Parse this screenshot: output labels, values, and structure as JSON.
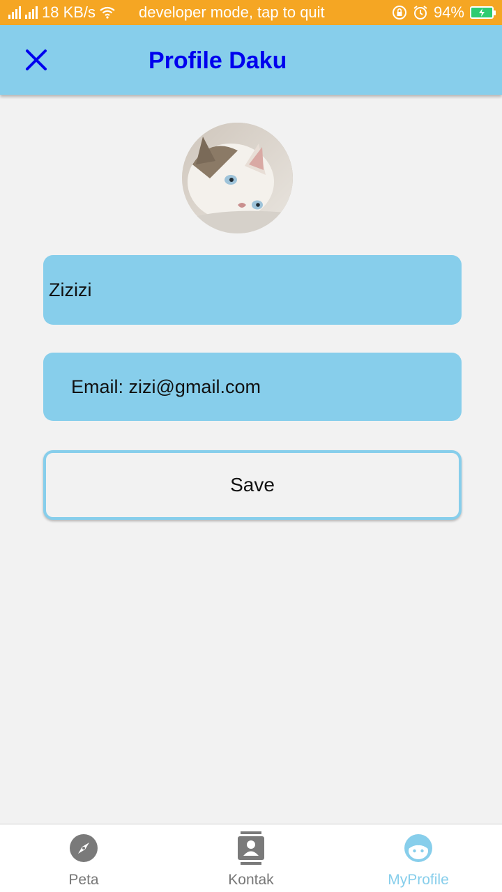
{
  "status_bar": {
    "speed": "18 KB/s",
    "notice": "developer mode, tap to quit",
    "battery": "94%",
    "icons": [
      "signal-icon",
      "wifi-icon",
      "rotation-lock-icon",
      "alarm-icon",
      "battery-icon"
    ]
  },
  "app_bar": {
    "title": "Profile Daku",
    "close_icon": "close-icon",
    "background": "#87ceeb",
    "title_color": "#0000ee"
  },
  "profile": {
    "avatar": "cat-photo",
    "name_value": "Zizizi",
    "email_value": "Email: zizi@gmail.com",
    "save_label": "Save"
  },
  "bottom_nav": {
    "items": [
      {
        "label": "Peta",
        "icon": "compass-icon",
        "active": false
      },
      {
        "label": "Kontak",
        "icon": "contacts-icon",
        "active": false
      },
      {
        "label": "MyProfile",
        "icon": "face-icon",
        "active": true
      }
    ],
    "active_color": "#87ceeb",
    "inactive_color": "#777777"
  }
}
